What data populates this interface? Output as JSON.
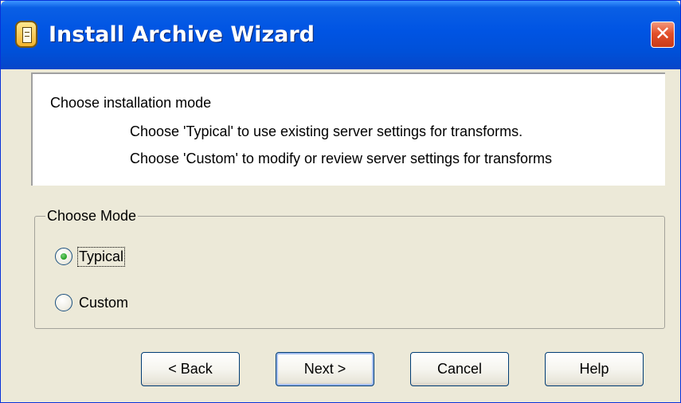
{
  "window": {
    "title": "Install Archive Wizard",
    "close_symbol": "✕"
  },
  "header": {
    "title": "Choose installation mode",
    "line1": "Choose 'Typical' to use existing server settings for transforms.",
    "line2": "Choose 'Custom' to modify or review server settings for transforms"
  },
  "mode_group": {
    "legend": "Choose Mode",
    "options": [
      {
        "label": "Typical",
        "selected": true
      },
      {
        "label": "Custom",
        "selected": false
      }
    ]
  },
  "buttons": {
    "back": "< Back",
    "next": "Next >",
    "cancel": "Cancel",
    "help": "Help"
  },
  "icons": {
    "app": "archive-document-icon",
    "close": "close-icon"
  },
  "colors": {
    "titlebar": "#0054e3",
    "close_button": "#e3502a",
    "background": "#ece9d8",
    "radio_dot": "#21a121"
  }
}
